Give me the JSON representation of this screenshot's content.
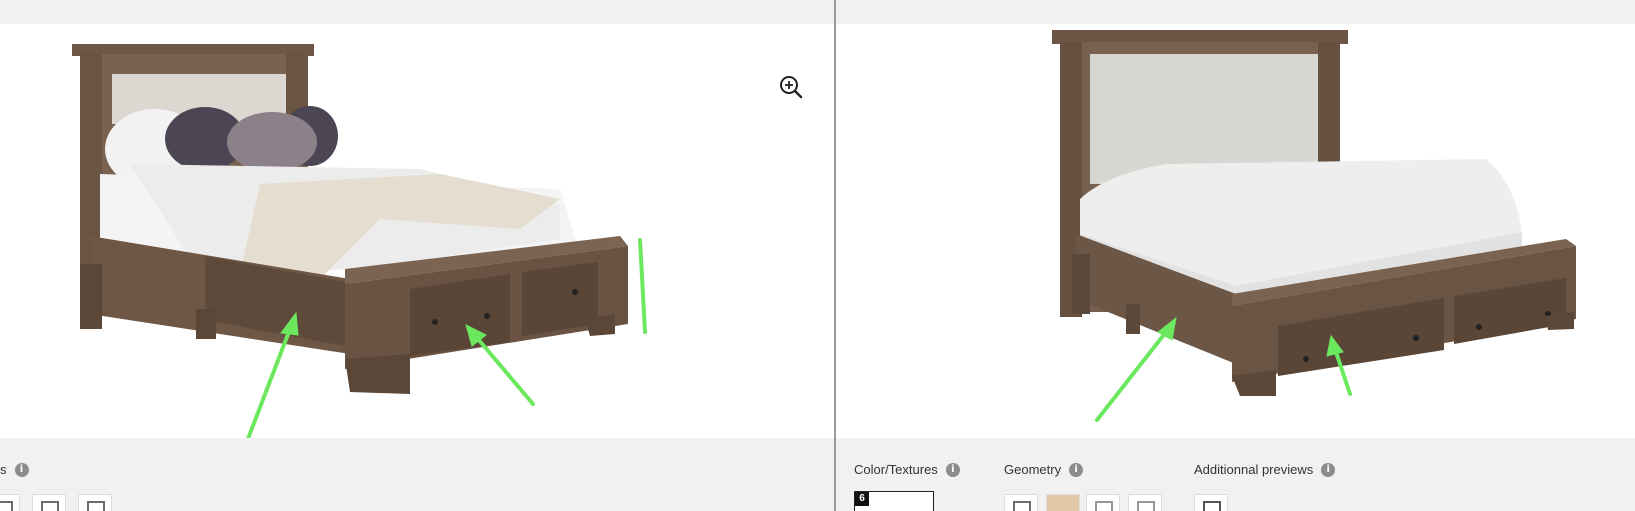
{
  "left_panel": {
    "toolbar_partial_label": "s",
    "info_icon_glyph": "i"
  },
  "right_panel": {
    "toolbar": {
      "color_textures": "Color/Textures",
      "geometry": "Geometry",
      "additional_previews": "Additionnal previews",
      "info_icon_glyph": "i"
    },
    "color_badge_number": "6"
  },
  "colors": {
    "background": "#f1f1f1",
    "viewer": "#ffffff",
    "arrow": "#6ce85e",
    "wood": "#6b5443",
    "fabric": "#d8d6d1",
    "mattress": "#eeeeee"
  }
}
